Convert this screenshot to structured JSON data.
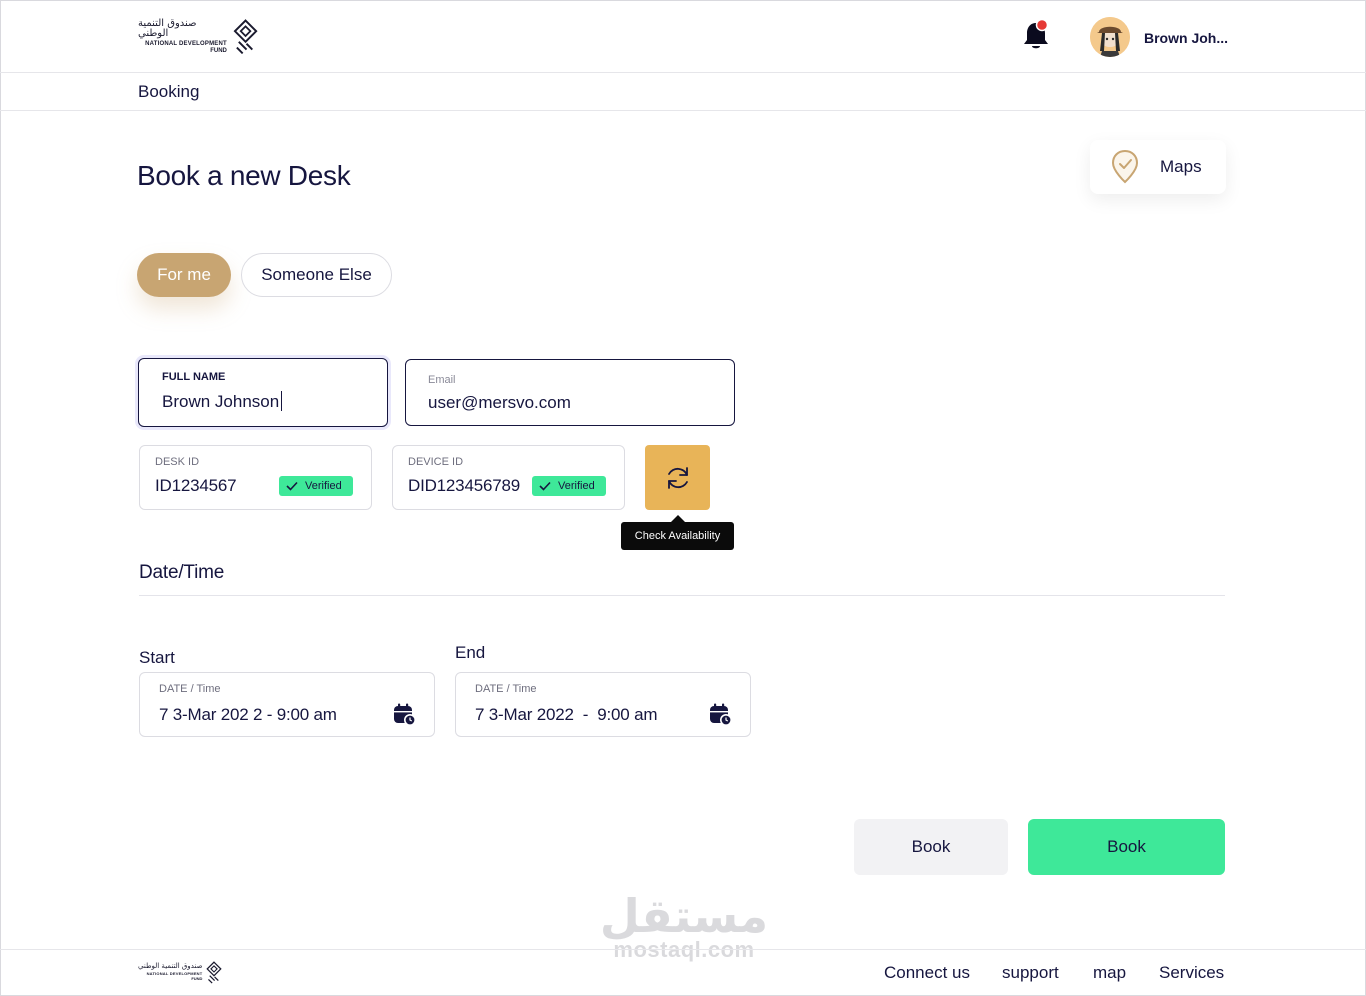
{
  "brand": {
    "arabic": "صندوق التنمية الوطني",
    "line1": "NATIONAL DEVELOPMENT",
    "line2": "FUND"
  },
  "header": {
    "user_name": "Brown Joh...",
    "notification_dot_color": "#e53935"
  },
  "breadcrumb": "Booking",
  "page_title": "Book a new Desk",
  "maps": {
    "label": "Maps"
  },
  "toggle": {
    "for_me": "For me",
    "someone_else": "Someone Else",
    "active_color": "#c8a572"
  },
  "form": {
    "full_name": {
      "label": "FULL NAME",
      "value": "Brown Johnson"
    },
    "email": {
      "label": "Email",
      "value": "user@mersvo.com"
    },
    "desk_id": {
      "label": "DESK ID",
      "value": "ID1234567",
      "badge": "Verified"
    },
    "device_id": {
      "label": "DEVICE ID",
      "value": "DID123456789",
      "badge": "Verified"
    },
    "check_tooltip": "Check Availability"
  },
  "datetime": {
    "section_title": "Date/Time",
    "start": {
      "label": "Start",
      "small": "DATE / Time",
      "value": "7 3-Mar 202 2 - 9:00 am"
    },
    "end": {
      "label": "End",
      "small": "DATE / Time",
      "value": "7 3-Mar 2022  -  9:00 am"
    }
  },
  "actions": {
    "secondary": "Book",
    "primary": "Book",
    "primary_color": "#3ee899"
  },
  "watermark": {
    "arabic": "مستقل",
    "latin": "mostaql.com"
  },
  "footer": {
    "links": [
      "Connect us",
      "support",
      "map",
      "Services"
    ]
  }
}
